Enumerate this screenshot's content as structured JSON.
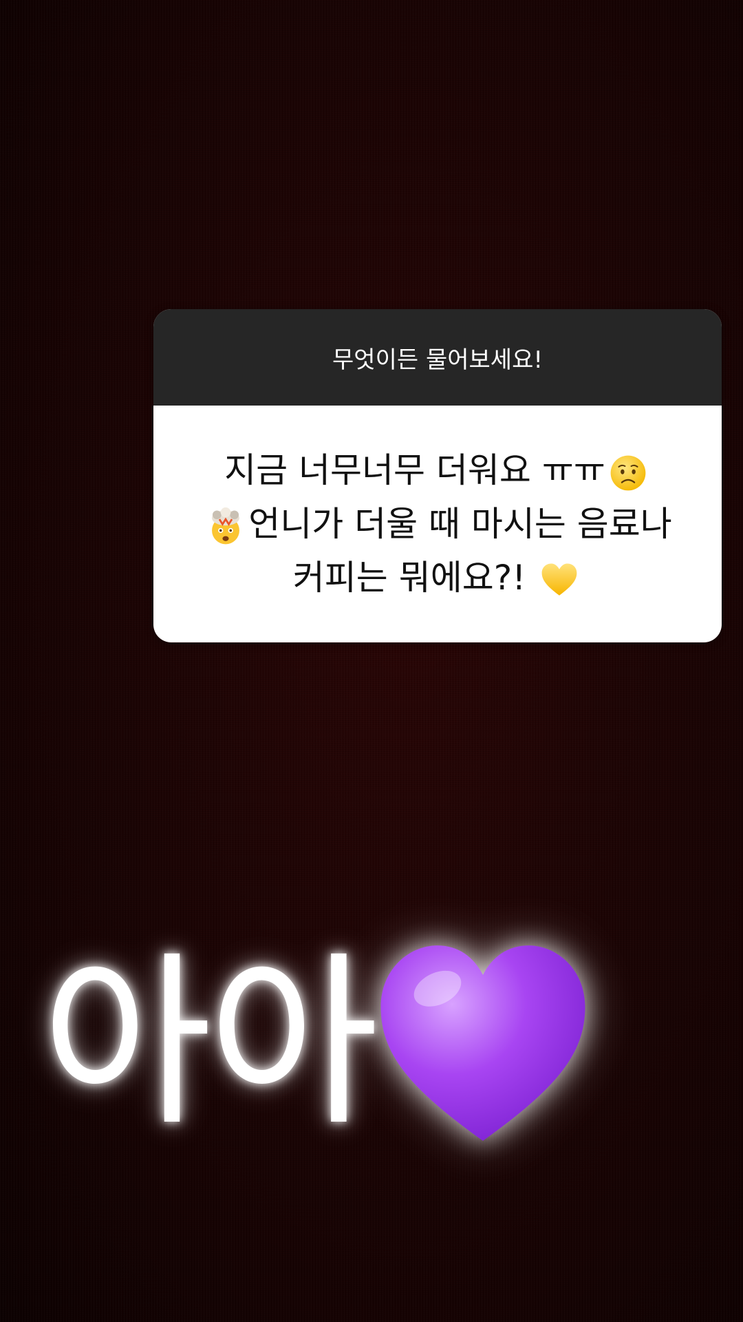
{
  "question_sticker": {
    "header": "무엇이든 물어보세요!",
    "question_line1": "지금 너무너무 더워요 ㅠㅠ",
    "question_line2": "언니가 더울 때 마시는 음료나",
    "question_line3": "커피는 뭐에요?!",
    "emojis": [
      "worried-face-icon",
      "exploding-head-icon",
      "yellow-heart-icon"
    ]
  },
  "reply": {
    "text": "아아",
    "emoji": "purple-heart-icon"
  },
  "colors": {
    "background": "#1f0505",
    "card_header": "#262626",
    "card_body": "#ffffff",
    "purple_heart": "#a43af0",
    "yellow_heart": "#ffcc2e"
  }
}
